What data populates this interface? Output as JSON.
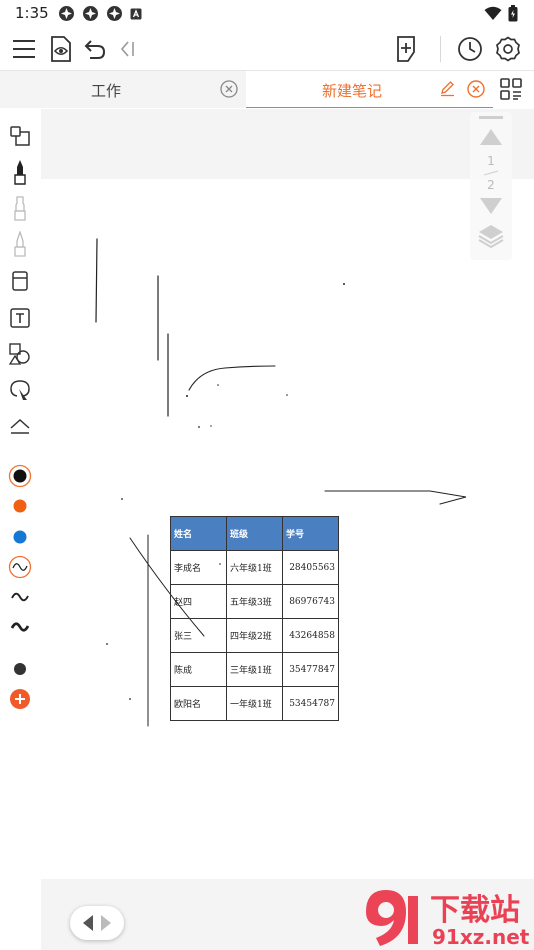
{
  "status_bar": {
    "time": "1:35"
  },
  "tabs": [
    {
      "label": "工作",
      "active": false
    },
    {
      "label": "新建笔记",
      "active": true
    }
  ],
  "accent_color": "#f07030",
  "page_nav": {
    "current_page": "1",
    "total_pages": "2"
  },
  "table": {
    "headers": [
      "姓名",
      "班级",
      "学号"
    ],
    "rows": [
      [
        "李成名",
        "六年级1班",
        "28405563"
      ],
      [
        "赵四",
        "五年级3班",
        "86976743"
      ],
      [
        "张三",
        "四年级2班",
        "43264858"
      ],
      [
        "陈成",
        "三年级1班",
        "35477847"
      ],
      [
        "欧阳名",
        "一年级1班",
        "53454787"
      ]
    ]
  },
  "icons": {
    "toolbar": [
      "menu-icon",
      "preview-icon",
      "undo-icon",
      "collapse-icon",
      "add-page-icon",
      "history-icon",
      "settings-icon"
    ],
    "tools": [
      "select-icon",
      "pen-icon",
      "pencil-icon",
      "marker-icon",
      "eraser-icon",
      "text-icon",
      "shape-icon",
      "lasso-icon",
      "collapse-tools-icon"
    ]
  },
  "colors": {
    "palette": [
      "#111111",
      "#f06010",
      "#1478d4"
    ],
    "extra_dot": "#333333",
    "add_color": "#f05a2a"
  },
  "watermark": {
    "line1": "下载站",
    "line2": "91xz.net"
  }
}
